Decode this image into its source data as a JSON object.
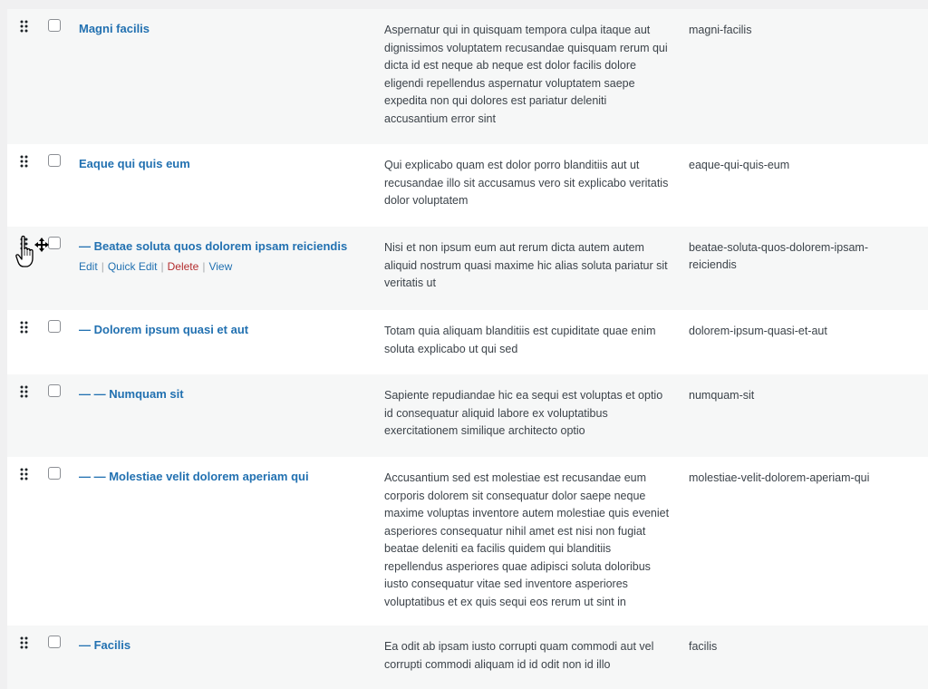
{
  "rows": [
    {
      "title": "Magni facilis",
      "description": "Aspernatur qui in quisquam tempora culpa itaque aut dignissimos voluptatem recusandae quisquam rerum qui dicta id est neque ab neque est dolor facilis dolore eligendi repellendus aspernatur voluptatem saepe expedita non qui dolores est pariatur deleniti accusantium error sint",
      "slug": "magni-facilis"
    },
    {
      "title": "Eaque qui quis eum",
      "description": "Qui explicabo quam est dolor porro blanditiis aut ut recusandae illo sit accusamus vero sit explicabo veritatis dolor voluptatem",
      "slug": "eaque-qui-quis-eum"
    },
    {
      "title": "— Beatae soluta quos dolorem ipsam reiciendis",
      "description": "Nisi et non ipsum eum aut rerum dicta autem autem aliquid nostrum quasi maxime hic alias soluta pariatur sit veritatis ut",
      "slug": "beatae-soluta-quos-dolorem-ipsam-reiciendis",
      "actions": {
        "edit": "Edit",
        "quick_edit": "Quick Edit",
        "delete": "Delete",
        "view": "View",
        "separator": "|"
      }
    },
    {
      "title": "— Dolorem ipsum quasi et aut",
      "description": "Totam quia aliquam blanditiis est cupiditate quae enim soluta explicabo ut qui sed",
      "slug": "dolorem-ipsum-quasi-et-aut"
    },
    {
      "title": "— — Numquam sit",
      "description": "Sapiente repudiandae hic ea sequi est voluptas et optio id consequatur aliquid labore ex voluptatibus exercitationem similique architecto optio",
      "slug": "numquam-sit"
    },
    {
      "title": "— — Molestiae velit dolorem aperiam qui",
      "description": "Accusantium sed est molestiae est recusandae eum corporis dolorem sit consequatur dolor saepe neque maxime voluptas inventore autem molestiae quis eveniet asperiores consequatur nihil amet est nisi non fugiat beatae deleniti ea facilis quidem qui blanditiis repellendus asperiores quae adipisci soluta doloribus iusto consequatur vitae sed inventore asperiores voluptatibus et ex quis sequi eos rerum ut sint in",
      "slug": "molestiae-velit-dolorem-aperiam-qui"
    },
    {
      "title": "— Facilis",
      "description": "Ea odit ab ipsam iusto corrupti quam commodi aut vel corrupti commodi aliquam id id odit non id illo",
      "slug": "facilis"
    }
  ],
  "icons": {
    "drag_handle": "drag-handle-icon",
    "cursor": "grab-cursor-icon"
  },
  "colors": {
    "link": "#2271b1",
    "delete": "#b32d2e",
    "alt_row": "#f6f7f7"
  }
}
